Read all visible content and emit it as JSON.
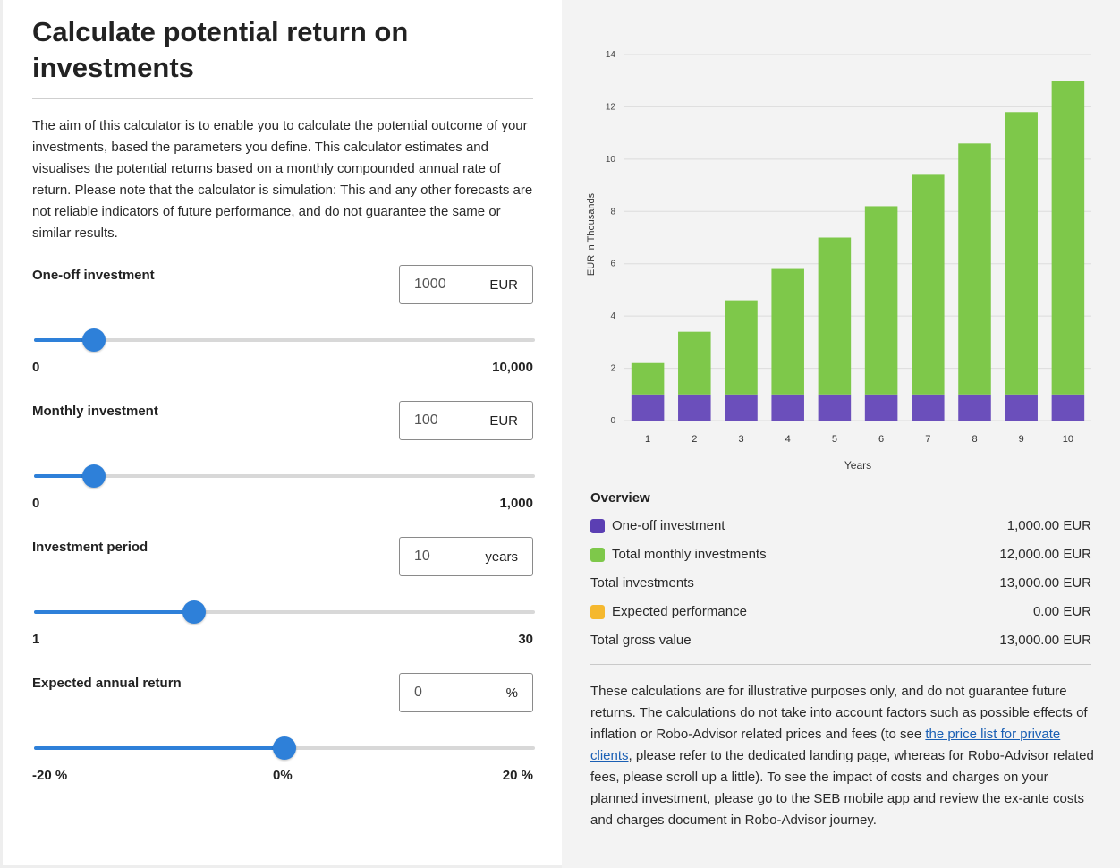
{
  "title": "Calculate potential return on investments",
  "intro": "The aim of this calculator is to enable you to calculate the potential outcome of your investments, based the parameters you define. This calculator estimates and visualises the potential returns based on a monthly compounded annual rate of return. Please note that the calculator is simulation: This and any other forecasts are not reliable indicators of future performance, and do not guarantee the same or similar results.",
  "fields": {
    "one_off": {
      "label": "One-off investment",
      "value": "1000",
      "unit": "EUR",
      "min_label": "0",
      "max_label": "10,000",
      "slider_fraction": 0.12
    },
    "monthly": {
      "label": "Monthly investment",
      "value": "100",
      "unit": "EUR",
      "min_label": "0",
      "max_label": "1,000",
      "slider_fraction": 0.12
    },
    "period": {
      "label": "Investment period",
      "value": "10",
      "unit": "years",
      "min_label": "1",
      "max_label": "30",
      "slider_fraction": 0.32
    },
    "annual_return": {
      "label": "Expected annual return",
      "value": "0",
      "unit": "%",
      "min_label": "-20 %",
      "mid_label": "0%",
      "max_label": "20 %",
      "slider_fraction": 0.5
    }
  },
  "chart_data": {
    "type": "bar",
    "stacked": true,
    "categories": [
      "1",
      "2",
      "3",
      "4",
      "5",
      "6",
      "7",
      "8",
      "9",
      "10"
    ],
    "series": [
      {
        "name": "One-off investment",
        "color": "#6b4fbb",
        "values": [
          1,
          1,
          1,
          1,
          1,
          1,
          1,
          1,
          1,
          1
        ]
      },
      {
        "name": "Total monthly investments",
        "color": "#7ec84a",
        "values": [
          1.2,
          2.4,
          3.6,
          4.8,
          6.0,
          7.2,
          8.4,
          9.6,
          10.8,
          12.0
        ]
      }
    ],
    "xlabel": "Years",
    "ylabel": "EUR in Thousands",
    "ylim": [
      0,
      14
    ],
    "yticks": [
      0,
      2,
      4,
      6,
      8,
      10,
      12,
      14
    ],
    "grid": true,
    "legend": "none"
  },
  "overview": {
    "title": "Overview",
    "rows": [
      {
        "label": "One-off investment",
        "value": "1,000.00 EUR",
        "swatch": "#5b3fb3"
      },
      {
        "label": "Total monthly investments",
        "value": "12,000.00 EUR",
        "swatch": "#7ec84a"
      },
      {
        "label": "Total investments",
        "value": "13,000.00 EUR"
      },
      {
        "label": "Expected performance",
        "value": "0.00 EUR",
        "swatch": "#f5b82e"
      },
      {
        "label": "Total gross value",
        "value": "13,000.00 EUR"
      }
    ]
  },
  "disclaimer": {
    "before": "These calculations are for illustrative purposes only, and do not guarantee future returns. The calculations do not take into account factors such as possible effects of inflation or Robo-Advisor related prices and fees (to see ",
    "link": "the price list for private clients",
    "after": ", please refer to the dedicated landing page, whereas for Robo-Advisor related fees, please scroll up a little). To see the impact of costs and charges on your planned investment, please go to the SEB mobile app and review the ex-ante costs and charges document in Robo-Advisor journey."
  }
}
